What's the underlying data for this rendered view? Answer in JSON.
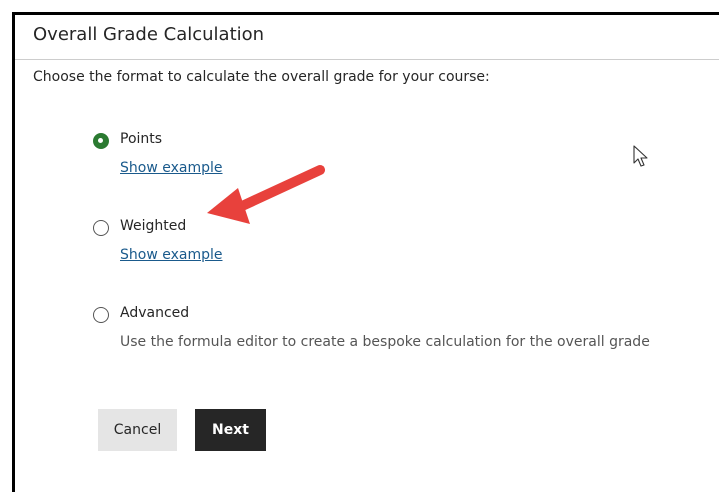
{
  "dialog": {
    "title": "Overall Grade Calculation",
    "instructions": "Choose the format to calculate the overall grade for your course:"
  },
  "options": [
    {
      "label": "Points",
      "selected": true,
      "link": "Show example"
    },
    {
      "label": "Weighted",
      "selected": false,
      "link": "Show example"
    },
    {
      "label": "Advanced",
      "selected": false,
      "description": "Use the formula editor to create a bespoke calculation for the overall grade"
    }
  ],
  "buttons": {
    "cancel": "Cancel",
    "next": "Next"
  },
  "colors": {
    "accent": "#2b7a31",
    "link": "#1a5a8c",
    "primary_button": "#262626",
    "secondary_button": "#e5e5e5",
    "annotation_arrow": "#e8413c"
  },
  "icons": {
    "annotation": "red-arrow-icon",
    "pointer": "mouse-pointer-icon"
  }
}
